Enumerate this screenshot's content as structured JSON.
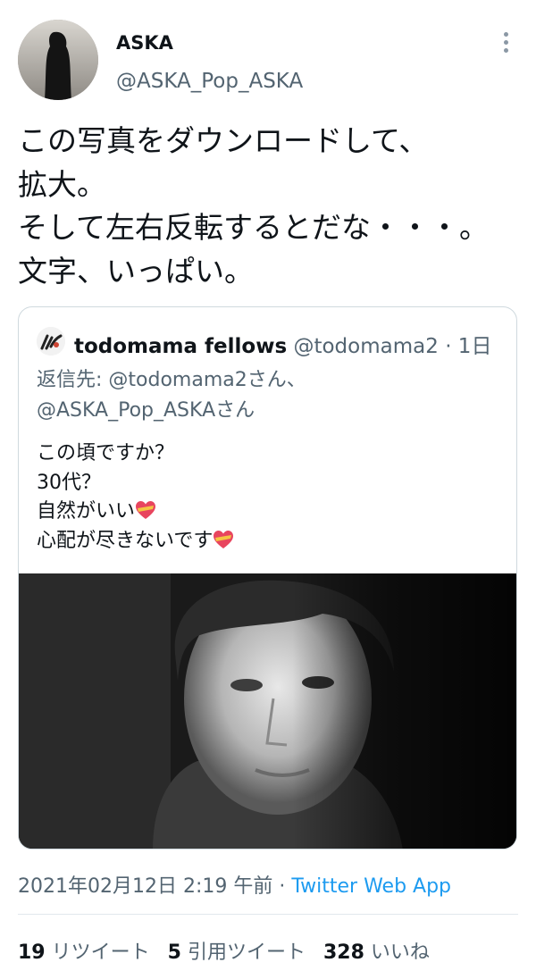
{
  "author": {
    "display_name": "ASKA",
    "handle": "@ASKA_Pop_ASKA",
    "avatar_icon": "profile-photo"
  },
  "tweet": {
    "lines": [
      "この写真をダウンロードして、",
      "拡大。",
      "そして左右反転するとだな・・・。",
      "文字、いっぱい。"
    ]
  },
  "quoted": {
    "display_name": "todomama fellows",
    "handle": "@todomama2",
    "time": "· 1日",
    "reply_label": "返信先: ",
    "reply_to_1": "@todomama2さん、",
    "reply_to_2": "@ASKA_Pop_ASKAさん",
    "lines": [
      "この頃ですか？",
      "30代？",
      "自然がいい",
      "心配が尽きないです"
    ],
    "photo_desc": "black-and-white portrait photo"
  },
  "meta": {
    "timestamp": "2021年02月12日 2:19 午前",
    "separator": " · ",
    "app": "Twitter Web App"
  },
  "stats": {
    "retweets_count": "19",
    "retweets_label": "リツイート",
    "quotes_count": "5",
    "quotes_label": "引用ツイート",
    "likes_count": "328",
    "likes_label": "いいね"
  },
  "colors": {
    "text": "#0f1419",
    "secondary": "#536471",
    "link": "#1d9bf0",
    "border": "#cfd9de"
  }
}
